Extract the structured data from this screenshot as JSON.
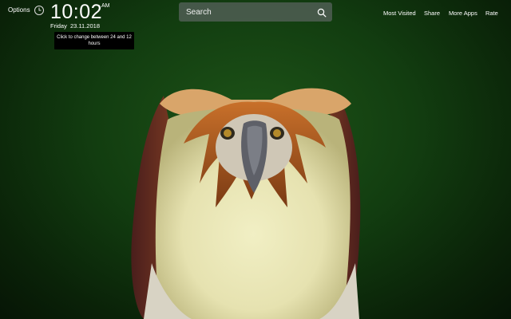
{
  "header": {
    "options_label": "Options",
    "clock": {
      "time": "10:02",
      "ampm": "AM",
      "day": "Friday",
      "date": "23.11.2018",
      "tooltip": "Click to change between 24 and 12 hours"
    }
  },
  "search": {
    "placeholder": "Search",
    "value": ""
  },
  "nav": {
    "items": [
      "Most Visited",
      "Share",
      "More Apps",
      "Rate"
    ]
  },
  "icons": {
    "clock": "clock-icon",
    "search": "search-icon"
  },
  "background": {
    "subject": "eagle"
  },
  "colors": {
    "background_green": "#123d10",
    "search_box": "#5a645f",
    "tooltip_bg": "#000000"
  }
}
